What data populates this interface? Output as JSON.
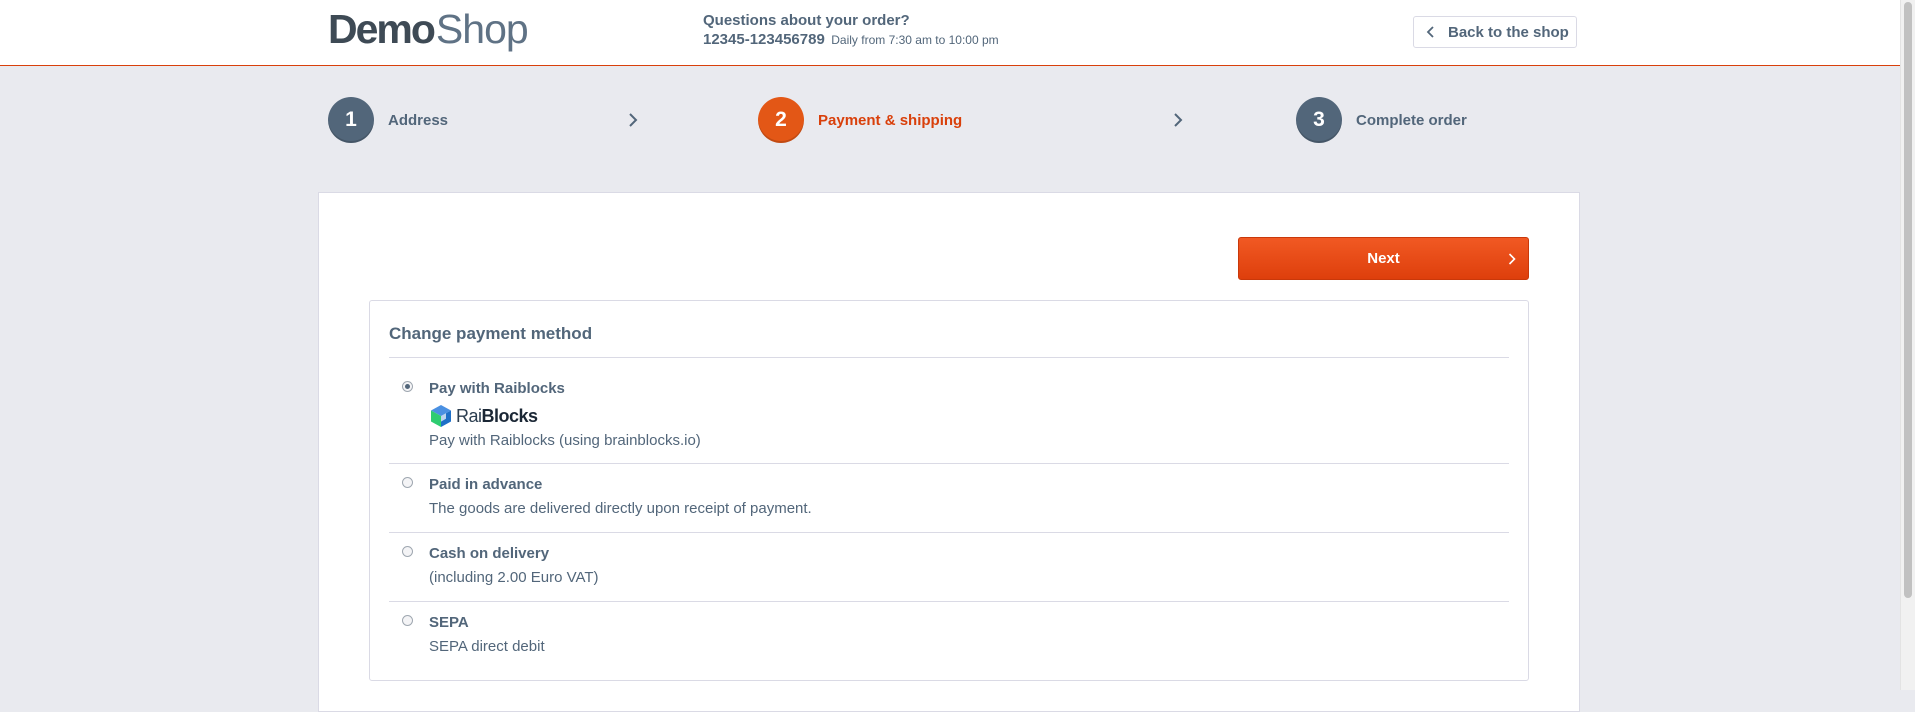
{
  "header": {
    "logo_demo": "Demo",
    "logo_shop": "Shop",
    "service_title": "Questions about your order?",
    "service_phone": "12345-123456789",
    "service_hours": "Daily from 7:30 am to 10:00 pm",
    "back_label": "Back to the shop"
  },
  "steps": [
    {
      "number": "1",
      "label": "Address"
    },
    {
      "number": "2",
      "label": "Payment & shipping"
    },
    {
      "number": "3",
      "label": "Complete order"
    }
  ],
  "next_label": "Next",
  "payment": {
    "title": "Change payment method",
    "methods": [
      {
        "name": "Pay with Raiblocks",
        "logo_rai": "Rai",
        "logo_blocks": "Blocks",
        "description": "Pay with Raiblocks (using brainblocks.io)",
        "selected": true
      },
      {
        "name": "Paid in advance",
        "description": "The goods are delivered directly upon receipt of payment.",
        "selected": false
      },
      {
        "name": "Cash on delivery",
        "description": "(including 2.00 Euro VAT)",
        "selected": false
      },
      {
        "name": "SEPA",
        "description": "SEPA direct debit",
        "selected": false
      }
    ]
  },
  "colors": {
    "accent": "#e35716",
    "active_text": "#d9400b",
    "text": "#52667a",
    "background": "#e9eaef"
  }
}
